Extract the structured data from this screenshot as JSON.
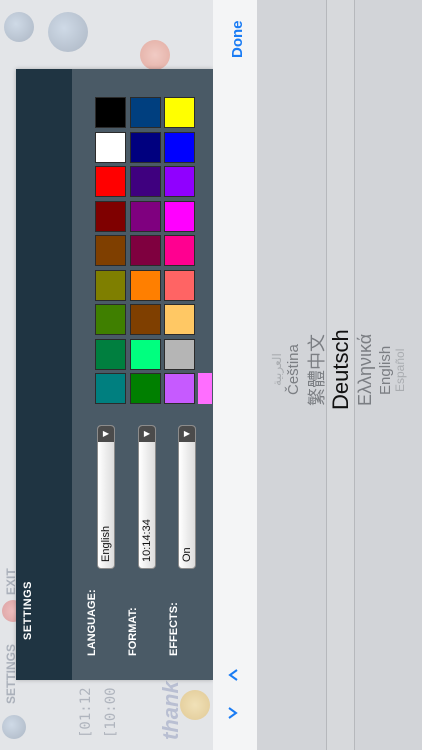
{
  "background_app": {
    "bottom_menu": [
      "SETTINGS",
      "EXIT"
    ],
    "times": [
      "[01:12",
      "[10:00"
    ],
    "greeting": "thank"
  },
  "settings": {
    "title": "SETTINGS",
    "rows": [
      {
        "label": "LANGUAGE:",
        "value": "English"
      },
      {
        "label": "FORMAT:",
        "value": "10:14:34"
      },
      {
        "label": "EFFECTS:",
        "value": "On"
      }
    ],
    "colors": [
      [
        "#007f7f",
        "#007f3f",
        "#3f7f00",
        "#7f7f00",
        "#7f3f00",
        "#7f0000",
        "#ff0000",
        "#ffffff",
        "#000000"
      ],
      [
        "#007f00",
        "#00ff7f",
        "#7f3f00",
        "#ff7f00",
        "#7f003f",
        "#7f007f",
        "#3f007f",
        "#00007f",
        "#003f7f"
      ],
      [
        "#c65aff",
        "#b5b5b5",
        "#ffc864",
        "#ff6464",
        "#ff0090",
        "#ff00ff",
        "#9000ff",
        "#0000ff",
        "#ffff00"
      ],
      [
        "#ff6eff"
      ]
    ]
  },
  "picker": {
    "done_label": "Done",
    "options": [
      "العربية",
      "Čeština",
      "繁體中文",
      "Deutsch",
      "Ελληνικά",
      "English",
      "Español"
    ],
    "selected": "Deutsch"
  }
}
